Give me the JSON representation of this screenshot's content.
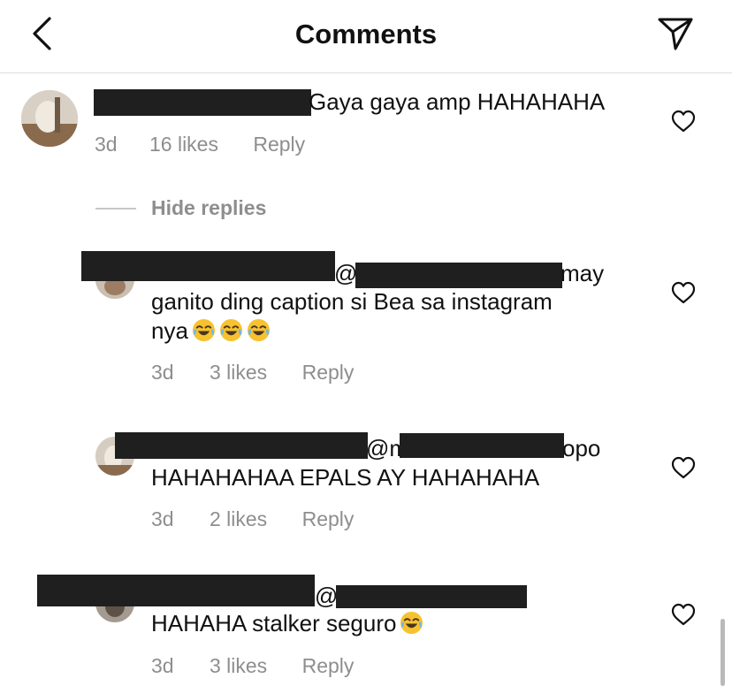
{
  "header": {
    "title": "Comments"
  },
  "comments": [
    {
      "text": "Gaya gaya amp HAHAHAHA",
      "time": "3d",
      "likes": "16 likes",
      "reply": "Reply"
    },
    {
      "mention": "@",
      "text_tail": "may",
      "text_line2": "ganito ding caption si Bea sa instagram",
      "text_line3": "nya",
      "time": "3d",
      "likes": "3 likes",
      "reply": "Reply"
    },
    {
      "mention": "@m",
      "text_tail": "opo",
      "text_line2": "HAHAHAHAA EPALS AY HAHAHAHA",
      "time": "3d",
      "likes": "2 likes",
      "reply": "Reply"
    },
    {
      "mention": "@",
      "text_line2": "HAHAHA stalker seguro",
      "time": "3d",
      "likes": "3 likes",
      "reply": "Reply"
    }
  ],
  "thread": {
    "hide_replies": "Hide replies"
  },
  "icons": {
    "back": "chevron-left-icon",
    "send": "paper-plane-icon",
    "like": "heart-outline-icon",
    "emoji": "face-with-tears-of-joy-emoji"
  },
  "colors": {
    "secondary_text": "#8e8e8e",
    "redaction": "#1f1f1f",
    "emoji_yellow": "#f6c230"
  }
}
